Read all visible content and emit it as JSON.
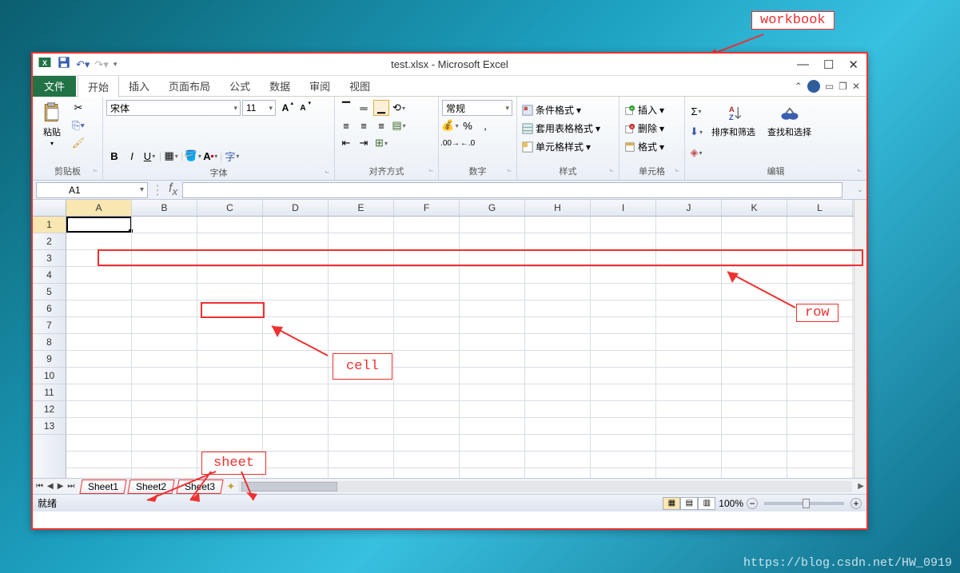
{
  "window": {
    "title": "test.xlsx - Microsoft Excel"
  },
  "qat": {
    "save": "save-icon",
    "undo": "undo-icon",
    "redo": "redo-icon"
  },
  "ribbon_tabs": {
    "file": "文件",
    "items": [
      "开始",
      "插入",
      "页面布局",
      "公式",
      "数据",
      "审阅",
      "视图"
    ]
  },
  "ribbon": {
    "clipboard": {
      "label": "剪贴板",
      "paste": "粘贴"
    },
    "font": {
      "label": "字体",
      "name": "宋体",
      "size": "11"
    },
    "alignment": {
      "label": "对齐方式"
    },
    "number": {
      "label": "数字",
      "format": "常规"
    },
    "styles": {
      "label": "样式",
      "cond": "条件格式",
      "table": "套用表格格式",
      "cell": "单元格样式"
    },
    "cells": {
      "label": "单元格",
      "insert": "插入",
      "delete": "删除",
      "format": "格式"
    },
    "editing": {
      "label": "编辑",
      "sort": "排序和筛选",
      "find": "查找和选择"
    }
  },
  "name_box": "A1",
  "columns": [
    "A",
    "B",
    "C",
    "D",
    "E",
    "F",
    "G",
    "H",
    "I",
    "J",
    "K",
    "L"
  ],
  "rows": [
    1,
    2,
    3,
    4,
    5,
    6,
    7,
    8,
    9,
    10,
    11,
    12,
    13
  ],
  "selected": {
    "col": 0,
    "row": 0
  },
  "sheets": [
    "Sheet1",
    "Sheet2",
    "Sheet3"
  ],
  "status": {
    "ready": "就绪",
    "zoom": "100%"
  },
  "annotations": {
    "workbook": "workbook",
    "row": "row",
    "cell": "cell",
    "sheet": "sheet"
  },
  "watermark": "https://blog.csdn.net/HW_0919"
}
